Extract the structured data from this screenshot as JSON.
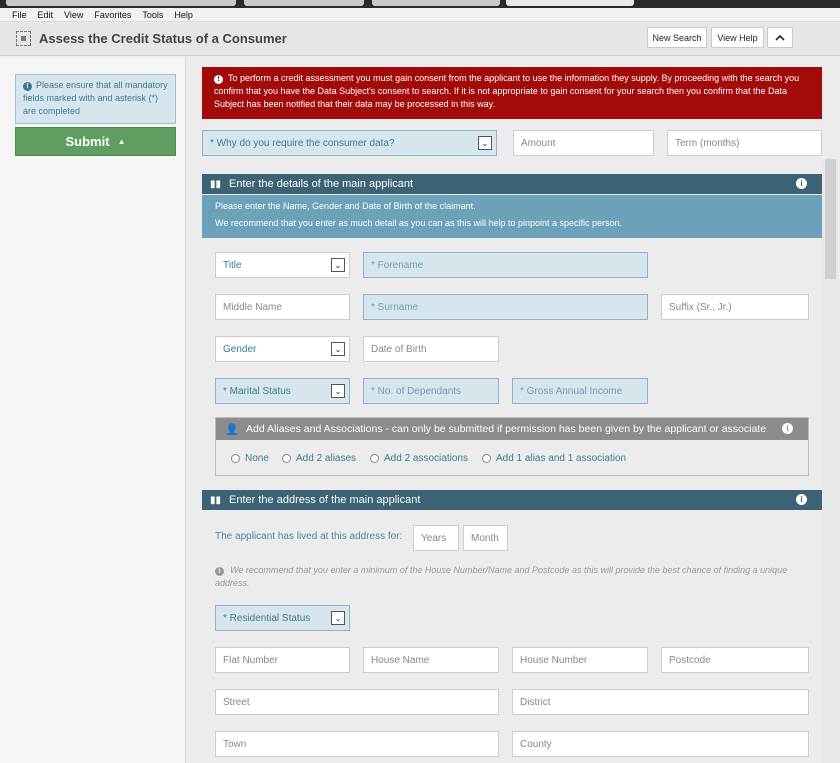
{
  "menu": [
    "File",
    "Edit",
    "View",
    "Favorites",
    "Tools",
    "Help"
  ],
  "header": {
    "title": "Assess the Credit Status of a Consumer",
    "new_search": "New Search",
    "view_help": "View Help",
    "collapse_icon": "chevron-up-icon"
  },
  "left": {
    "notice": "Please ensure that all mandatory fields marked with and asterisk (*) are completed",
    "submit": "Submit"
  },
  "alert": "To perform a credit assessment you must gain consent from the applicant to use the information they supply. By proceeding with the search you confirm that you have the Data Subject's consent to search. If it is not appropriate to gain consent for your search then you confirm that the Data Subject has been notified that their data may be processed in this way.",
  "purpose": {
    "select": "* Why do you require the consumer data?",
    "amount": "Amount",
    "term": "Term (months)"
  },
  "applicant": {
    "heading": "Enter the details of the main applicant",
    "line1": "Please enter the Name, Gender and Date of Birth of the claimant.",
    "line2": "We recommend that you enter as much detail as you can as this will help to pinpoint a specific person.",
    "title": "Title",
    "forename": "* Forename",
    "middle_name": "Middle Name",
    "surname": "* Surname",
    "suffix": "Suffix (Sr., Jr.)",
    "gender": "Gender",
    "dob": "Date of Birth",
    "marital": "* Marital Status",
    "dependants": "* No. of Dependants",
    "income": "* Gross Annual Income"
  },
  "aliases": {
    "heading": "Add Aliases and Associations - can only be submitted if permission has been given by the applicant or associate",
    "options": [
      "None",
      "Add 2 aliases",
      "Add 2 associations",
      "Add 1 alias and 1 association"
    ]
  },
  "address": {
    "heading": "Enter the address of the main applicant",
    "lived_label": "The applicant has lived at this address for:",
    "years": "Years",
    "month": "Month",
    "hint": "We recommend that you enter a minimum of the House Number/Name and Postcode as this will provide the best chance of finding a unique address.",
    "residential": "* Residential Status",
    "flat": "Flat Number",
    "house_name": "House Name",
    "house_number": "House Number",
    "postcode": "Postcode",
    "street": "Street",
    "district": "District",
    "town": "Town",
    "county": "County"
  }
}
